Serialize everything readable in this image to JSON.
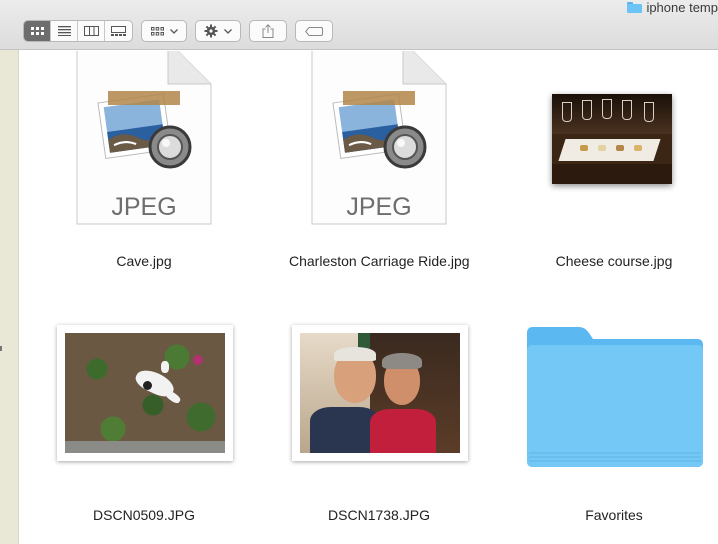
{
  "window": {
    "title": "iphone temp"
  },
  "toolbar": {
    "view_buttons": [
      "icon-view",
      "list-view",
      "column-view",
      "gallery-view"
    ],
    "active_view": "icon-view",
    "group_button": "group-icon",
    "action_button": "gear-icon",
    "share_button": "share-icon",
    "tags_button": "tag-icon"
  },
  "files": [
    {
      "name": "Cave.jpg",
      "kind": "jpeg-doc",
      "badge": "JPEG"
    },
    {
      "name": "Charleston Carriage Ride.jpg",
      "kind": "jpeg-doc",
      "badge": "JPEG"
    },
    {
      "name": "Cheese course.jpg",
      "kind": "photo-thumbnail"
    },
    {
      "name": "DSCN0509.JPG",
      "kind": "photo-thumbnail"
    },
    {
      "name": "DSCN1738.JPG",
      "kind": "photo-thumbnail"
    },
    {
      "name": "Favorites",
      "kind": "folder"
    }
  ],
  "colors": {
    "folder": "#6cc4f6",
    "toolbar": "#e4e4e4",
    "sidebar": "#e9e7d6"
  }
}
